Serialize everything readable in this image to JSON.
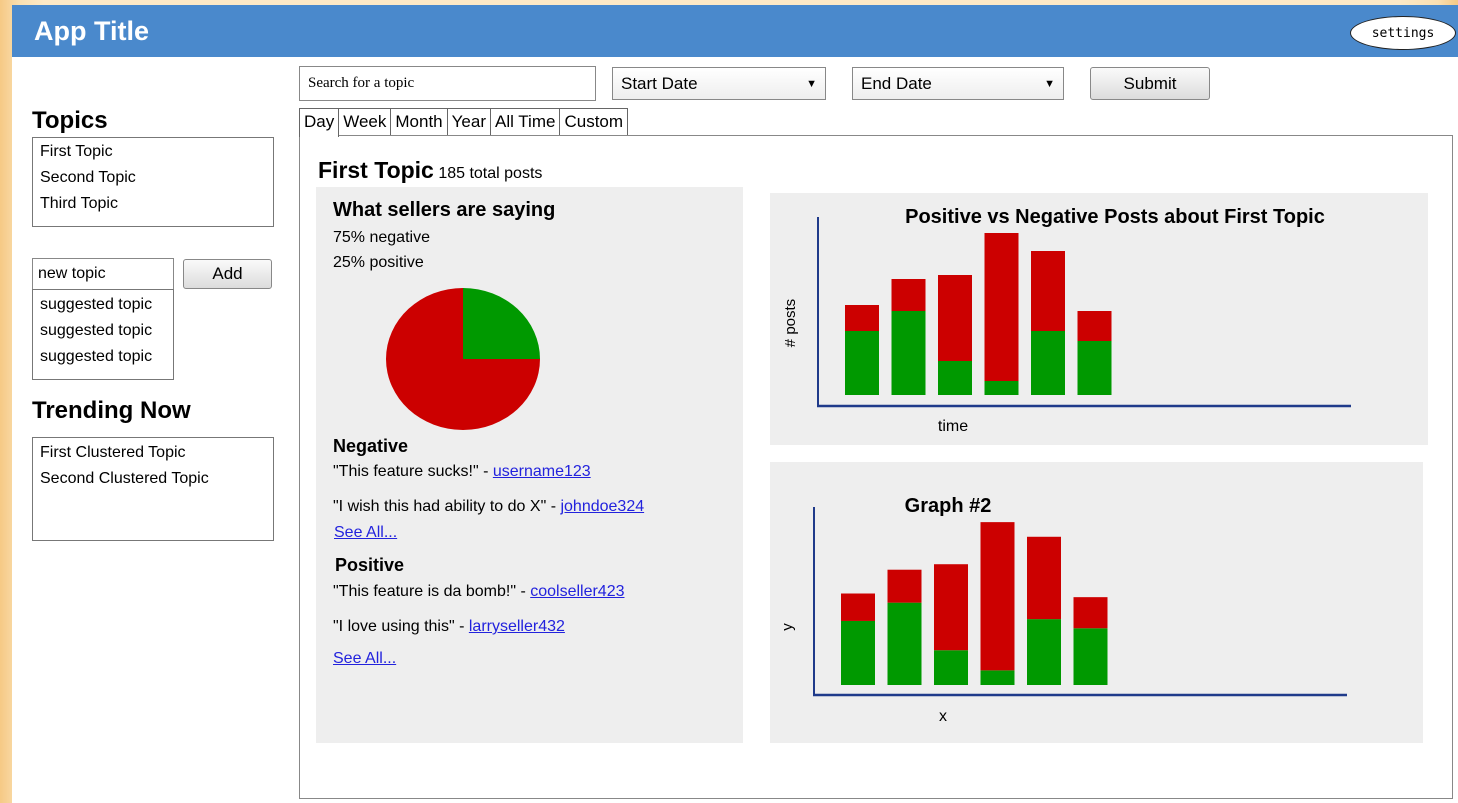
{
  "header": {
    "app_title": "App Title",
    "settings_label": "settings"
  },
  "sidebar": {
    "topics_heading": "Topics",
    "topics": [
      "First Topic",
      "Second Topic",
      "Third Topic"
    ],
    "new_topic_value": "new topic",
    "add_label": "Add",
    "suggested": [
      "suggested topic",
      "suggested topic",
      "suggested topic"
    ],
    "trending_heading": "Trending Now",
    "trending": [
      "First Clustered Topic",
      "Second Clustered Topic"
    ]
  },
  "toolbar": {
    "search_placeholder": "Search for a topic",
    "start_date": "Start Date",
    "end_date": "End Date",
    "submit_label": "Submit"
  },
  "tabs": [
    "Day",
    "Week",
    "Month",
    "Year",
    "All Time",
    "Custom"
  ],
  "active_tab": "Day",
  "main": {
    "topic_title": "First Topic",
    "total_posts": "185 total posts",
    "sellers_heading": "What sellers are saying",
    "negative_pct": "75% negative",
    "positive_pct": "25% positive",
    "negative_heading": "Negative",
    "negative_quotes": [
      {
        "quote": "\"This feature sucks!\" - ",
        "user": "username123"
      },
      {
        "quote": "\"I wish this had ability to do X\" -  ",
        "user": "johndoe324"
      }
    ],
    "see_all": "See All...",
    "positive_heading": "Positive",
    "positive_quotes": [
      {
        "quote": "\"This feature is da bomb!\" -  ",
        "user": "coolseller423"
      },
      {
        "quote": "\"I love using this\" -  ",
        "user": "larryseller432"
      }
    ]
  },
  "colors": {
    "negative": "#cc0000",
    "positive": "#009900",
    "axis": "#1f3a8a",
    "header": "#4a89cc"
  },
  "chart_data": [
    {
      "type": "pie",
      "slices": [
        {
          "label": "negative",
          "value": 75
        },
        {
          "label": "positive",
          "value": 25
        }
      ]
    },
    {
      "type": "bar",
      "stacked": true,
      "title": "Positive vs Negative Posts about First Topic",
      "xlabel": "time",
      "ylabel": "# posts",
      "categories": [
        "",
        "",
        "",
        "",
        "",
        ""
      ],
      "ylim": [
        0,
        100
      ],
      "series": [
        {
          "values": [
            32,
            42,
            17,
            7,
            32,
            27
          ]
        },
        {
          "values": [
            13,
            16,
            43,
            74,
            40,
            15
          ]
        }
      ]
    },
    {
      "type": "bar",
      "stacked": true,
      "title": "Graph #2",
      "xlabel": "x",
      "ylabel": "y",
      "categories": [
        "",
        "",
        "",
        "",
        "",
        ""
      ],
      "ylim": [
        0,
        100
      ],
      "series": [
        {
          "values": [
            35,
            45,
            19,
            8,
            36,
            31
          ]
        },
        {
          "values": [
            15,
            18,
            47,
            81,
            45,
            17
          ]
        }
      ]
    }
  ]
}
